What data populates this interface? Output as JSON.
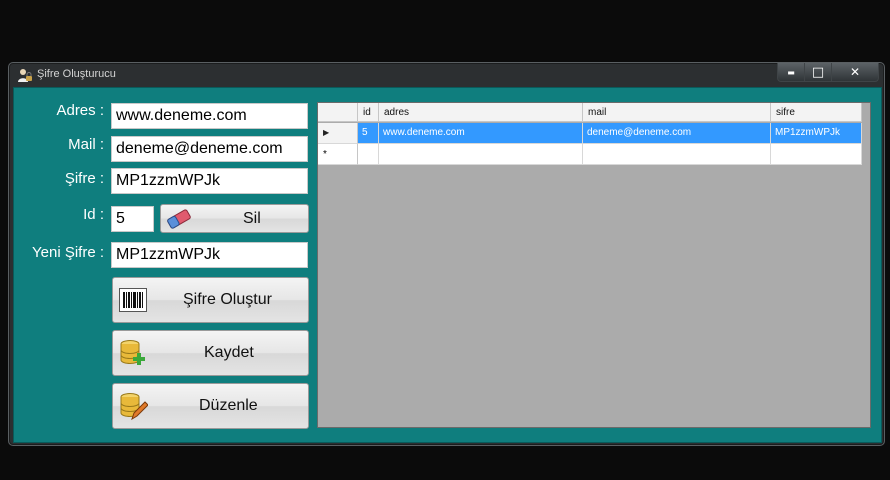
{
  "window": {
    "title": "Şifre Oluşturucu",
    "minimize_glyph": "▬",
    "maximize_glyph": "□",
    "close_glyph": "✕"
  },
  "form": {
    "adres_label": "Adres :",
    "adres_value": "www.deneme.com",
    "mail_label": "Mail :",
    "mail_value": "deneme@deneme.com",
    "sifre_label": "Şifre :",
    "sifre_value": "MP1zzmWPJk",
    "id_label": "Id :",
    "id_value": "5",
    "yeni_sifre_label": "Yeni Şifre :",
    "yeni_sifre_value": "MP1zzmWPJk"
  },
  "buttons": {
    "sil": "Sil",
    "sifre_olustur": "Şifre Oluştur",
    "kaydet": "Kaydet",
    "duzenle": "Düzenle"
  },
  "grid": {
    "columns": [
      "id",
      "adres",
      "mail",
      "sifre"
    ],
    "rows": [
      {
        "id": "5",
        "adres": "www.deneme.com",
        "mail": "deneme@deneme.com",
        "sifre": "MP1zzmWPJk",
        "selected": true
      }
    ],
    "new_row_marker": "*",
    "current_row_marker": "▶"
  },
  "colors": {
    "client_background": "#0f7e7e",
    "selection": "#3399ff",
    "grid_background": "#ababab"
  }
}
